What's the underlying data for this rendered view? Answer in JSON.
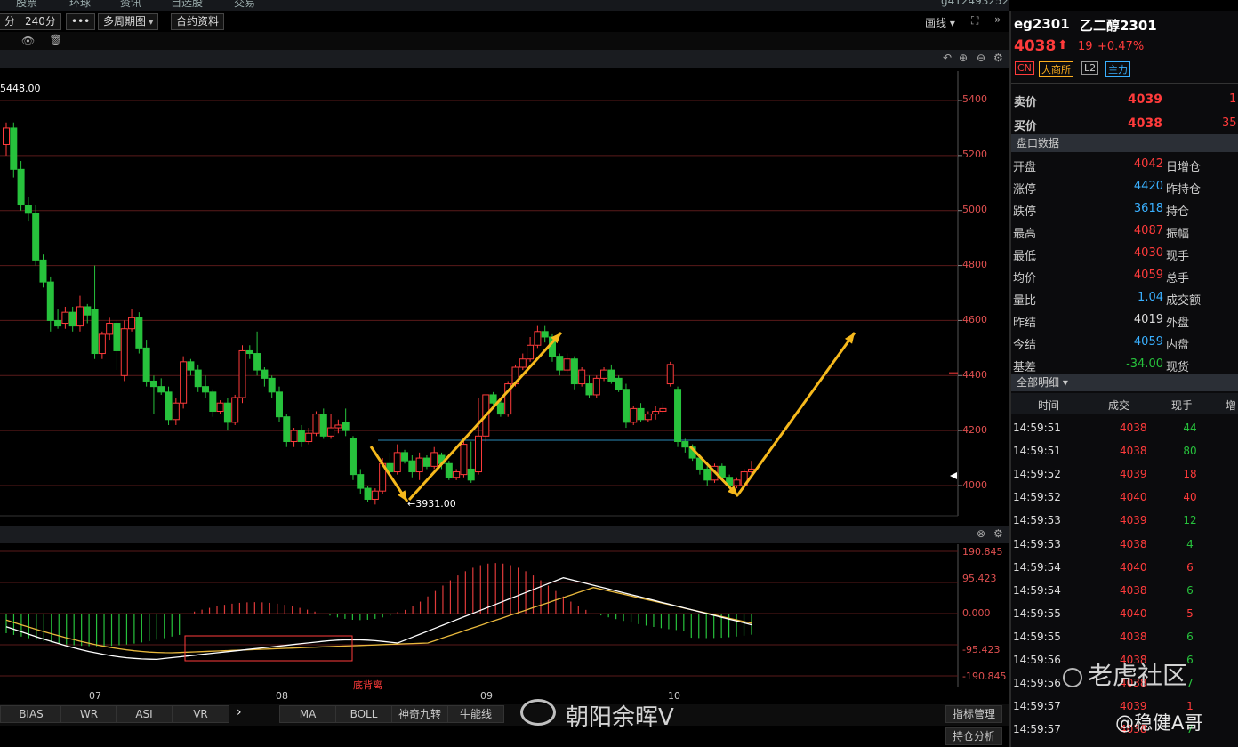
{
  "top_menu": [
    "股票",
    "环球",
    "资讯",
    "自选股",
    "交易"
  ],
  "search_text": "g412493252",
  "toolbar": {
    "period_fragment": "分",
    "period_240": "240分",
    "more": "•••",
    "multi_period": "多周期图",
    "contract_info": "合约资料",
    "draw_line": "画线"
  },
  "chart": {
    "price_max_label": "5448.00",
    "price_min_label": "3931.00",
    "divergence_label": "底背离",
    "price_axis": [
      "5400",
      "5200",
      "5000",
      "4800",
      "4600",
      "4400",
      "4200",
      "4000"
    ],
    "macd_axis": [
      "190.845",
      "95.423",
      "0.000",
      "-95.423",
      "-190.845"
    ],
    "x_ticks": [
      "07",
      "08",
      "09",
      "10"
    ]
  },
  "chart_data": {
    "type": "candlestick",
    "ylim": [
      3900,
      5480
    ],
    "candles": [
      [
        5240,
        5300,
        5200,
        5320
      ],
      [
        5300,
        5150,
        5120,
        5320
      ],
      [
        5150,
        5020,
        5000,
        5180
      ],
      [
        5020,
        4990,
        4960,
        5050
      ],
      [
        4990,
        4820,
        4800,
        5020
      ],
      [
        4820,
        4740,
        4720,
        4840
      ],
      [
        4740,
        4600,
        4560,
        4760
      ],
      [
        4600,
        4580,
        4570,
        4640
      ],
      [
        4590,
        4630,
        4570,
        4650
      ],
      [
        4630,
        4580,
        4560,
        4650
      ],
      [
        4580,
        4650,
        4560,
        4690
      ],
      [
        4650,
        4620,
        4590,
        4660
      ],
      [
        4640,
        4480,
        4460,
        4800
      ],
      [
        4480,
        4550,
        4460,
        4560
      ],
      [
        4550,
        4590,
        4530,
        4610
      ],
      [
        4590,
        4490,
        4420,
        4600
      ],
      [
        4400,
        4570,
        4380,
        4600
      ],
      [
        4570,
        4610,
        4560,
        4640
      ],
      [
        4610,
        4500,
        4480,
        4630
      ],
      [
        4500,
        4380,
        4360,
        4530
      ],
      [
        4380,
        4360,
        4260,
        4400
      ],
      [
        4360,
        4340,
        4330,
        4390
      ],
      [
        4340,
        4240,
        4220,
        4360
      ],
      [
        4240,
        4300,
        4220,
        4320
      ],
      [
        4300,
        4450,
        4280,
        4470
      ],
      [
        4450,
        4420,
        4400,
        4460
      ],
      [
        4420,
        4360,
        4340,
        4440
      ],
      [
        4360,
        4340,
        4320,
        4400
      ],
      [
        4340,
        4270,
        4250,
        4350
      ],
      [
        4270,
        4300,
        4260,
        4310
      ],
      [
        4300,
        4230,
        4200,
        4320
      ],
      [
        4230,
        4320,
        4220,
        4330
      ],
      [
        4320,
        4490,
        4300,
        4510
      ],
      [
        4490,
        4480,
        4460,
        4510
      ],
      [
        4480,
        4420,
        4400,
        4560
      ],
      [
        4420,
        4390,
        4360,
        4430
      ],
      [
        4390,
        4340,
        4320,
        4400
      ],
      [
        4340,
        4250,
        4230,
        4360
      ],
      [
        4250,
        4160,
        4140,
        4260
      ],
      [
        4160,
        4200,
        4140,
        4210
      ],
      [
        4200,
        4160,
        4140,
        4220
      ],
      [
        4160,
        4190,
        4150,
        4210
      ],
      [
        4190,
        4260,
        4180,
        4270
      ],
      [
        4260,
        4180,
        4170,
        4280
      ],
      [
        4180,
        4210,
        4170,
        4260
      ],
      [
        4210,
        4220,
        4190,
        4240
      ],
      [
        4230,
        4200,
        4180,
        4280
      ],
      [
        4170,
        4040,
        4020,
        4180
      ],
      [
        4040,
        3990,
        3970,
        4060
      ],
      [
        3990,
        3950,
        3940,
        4000
      ],
      [
        3950,
        3980,
        3931,
        3990
      ],
      [
        3980,
        4080,
        3970,
        4100
      ],
      [
        4080,
        4050,
        4030,
        4120
      ],
      [
        4050,
        4120,
        4040,
        4150
      ],
      [
        4120,
        4090,
        4080,
        4130
      ],
      [
        4090,
        4050,
        4030,
        4110
      ],
      [
        4050,
        4100,
        4020,
        4120
      ],
      [
        4100,
        4070,
        4060,
        4110
      ],
      [
        4070,
        4120,
        4060,
        4140
      ],
      [
        4110,
        4080,
        4060,
        4120
      ],
      [
        4080,
        4030,
        4020,
        4090
      ],
      [
        4030,
        4050,
        4020,
        4060
      ],
      [
        4040,
        4150,
        4030,
        4170
      ],
      [
        4060,
        4020,
        4010,
        4160
      ],
      [
        4050,
        4180,
        4040,
        4320
      ],
      [
        4180,
        4330,
        4160,
        4330
      ],
      [
        4330,
        4300,
        4290,
        4340
      ],
      [
        4300,
        4260,
        4250,
        4320
      ],
      [
        4260,
        4370,
        4250,
        4380
      ],
      [
        4370,
        4430,
        4360,
        4440
      ],
      [
        4430,
        4460,
        4420,
        4480
      ],
      [
        4460,
        4510,
        4450,
        4540
      ],
      [
        4510,
        4560,
        4500,
        4580
      ],
      [
        4560,
        4540,
        4520,
        4580
      ],
      [
        4540,
        4470,
        4450,
        4550
      ],
      [
        4470,
        4420,
        4400,
        4480
      ],
      [
        4420,
        4460,
        4410,
        4480
      ],
      [
        4460,
        4370,
        4350,
        4470
      ],
      [
        4370,
        4420,
        4360,
        4430
      ],
      [
        4370,
        4330,
        4320,
        4400
      ],
      [
        4330,
        4390,
        4320,
        4400
      ],
      [
        4390,
        4420,
        4380,
        4430
      ],
      [
        4420,
        4380,
        4370,
        4440
      ],
      [
        4390,
        4350,
        4340,
        4400
      ],
      [
        4350,
        4230,
        4210,
        4370
      ],
      [
        4230,
        4280,
        4220,
        4290
      ],
      [
        4280,
        4240,
        4230,
        4300
      ],
      [
        4240,
        4260,
        4230,
        4270
      ],
      [
        4260,
        4270,
        4240,
        4290
      ],
      [
        4270,
        4280,
        4260,
        4300
      ],
      [
        4370,
        4440,
        4360,
        4450
      ],
      [
        4350,
        4160,
        4140,
        4360
      ],
      [
        4160,
        4140,
        4120,
        4170
      ],
      [
        4140,
        4100,
        4090,
        4150
      ],
      [
        4100,
        4060,
        4040,
        4110
      ],
      [
        4060,
        4020,
        4000,
        4070
      ],
      [
        4020,
        4070,
        4010,
        4080
      ],
      [
        4070,
        4030,
        4020,
        4080
      ],
      [
        4030,
        4000,
        3990,
        4040
      ],
      [
        4000,
        4020,
        3990,
        4030
      ],
      [
        4000,
        4050,
        3990,
        4060
      ],
      [
        4050,
        4060,
        4040,
        4090
      ]
    ],
    "ref_line": 4165,
    "macd_range": [
      -190.845,
      190.845
    ]
  },
  "bottom_tabs": [
    "BIAS",
    "WR",
    "ASI",
    "VR",
    "MA",
    "BOLL",
    "神奇九转",
    "牛能线"
  ],
  "bottom_buttons": {
    "indicator_manage": "指标管理",
    "position_analysis": "持仓分析"
  },
  "watermarks": {
    "weibo": "朝阳余晖V",
    "laohu": "老虎社区",
    "author": "@稳健A哥"
  },
  "panel": {
    "code": "eg2301",
    "name": "乙二醇2301",
    "last": "4038",
    "change": "19",
    "pct": "+0.47%",
    "tags": [
      "CN",
      "大商所",
      "L2",
      "主力"
    ],
    "ask_label": "卖价",
    "ask": "4039",
    "ask_vol": "1",
    "bid_label": "买价",
    "bid": "4038",
    "bid_vol": "35",
    "section1": "盘口数据",
    "stats": [
      {
        "label": "开盘",
        "value": "4042",
        "color": "red",
        "label2": "日增仓"
      },
      {
        "label": "涨停",
        "value": "4420",
        "color": "blue",
        "label2": "昨持仓"
      },
      {
        "label": "跌停",
        "value": "3618",
        "color": "blue",
        "label2": "持仓"
      },
      {
        "label": "最高",
        "value": "4087",
        "color": "red",
        "label2": "振幅"
      },
      {
        "label": "最低",
        "value": "4030",
        "color": "red",
        "label2": "现手"
      },
      {
        "label": "均价",
        "value": "4059",
        "color": "red",
        "label2": "总手"
      },
      {
        "label": "量比",
        "value": "1.04",
        "color": "blue",
        "label2": "成交额"
      },
      {
        "label": "昨结",
        "value": "4019",
        "color": "white",
        "label2": "外盘"
      },
      {
        "label": "今结",
        "value": "4059",
        "color": "blue",
        "label2": "内盘"
      },
      {
        "label": "基差",
        "value": "-34.00",
        "color": "green",
        "label2": "现货"
      }
    ],
    "section2": "全部明细",
    "trade_headers": [
      "时间",
      "成交",
      "现手",
      "增"
    ],
    "trades": [
      {
        "time": "14:59:51",
        "price": "4038",
        "vol": "44",
        "vc": "green"
      },
      {
        "time": "14:59:51",
        "price": "4038",
        "vol": "80",
        "vc": "green"
      },
      {
        "time": "14:59:52",
        "price": "4039",
        "vol": "18",
        "vc": "red"
      },
      {
        "time": "14:59:52",
        "price": "4040",
        "vol": "40",
        "vc": "red"
      },
      {
        "time": "14:59:53",
        "price": "4039",
        "vol": "12",
        "vc": "green"
      },
      {
        "time": "14:59:53",
        "price": "4038",
        "vol": "4",
        "vc": "green"
      },
      {
        "time": "14:59:54",
        "price": "4040",
        "vol": "6",
        "vc": "red"
      },
      {
        "time": "14:59:54",
        "price": "4038",
        "vol": "6",
        "vc": "green"
      },
      {
        "time": "14:59:55",
        "price": "4040",
        "vol": "5",
        "vc": "red"
      },
      {
        "time": "14:59:55",
        "price": "4038",
        "vol": "6",
        "vc": "green"
      },
      {
        "time": "14:59:56",
        "price": "4038",
        "vol": "6",
        "vc": "green"
      },
      {
        "time": "14:59:56",
        "price": "4038",
        "vol": "7",
        "vc": "green"
      },
      {
        "time": "14:59:57",
        "price": "4039",
        "vol": "1",
        "vc": "red"
      },
      {
        "time": "14:59:57",
        "price": "4038",
        "vol": "7",
        "vc": "green"
      }
    ]
  }
}
